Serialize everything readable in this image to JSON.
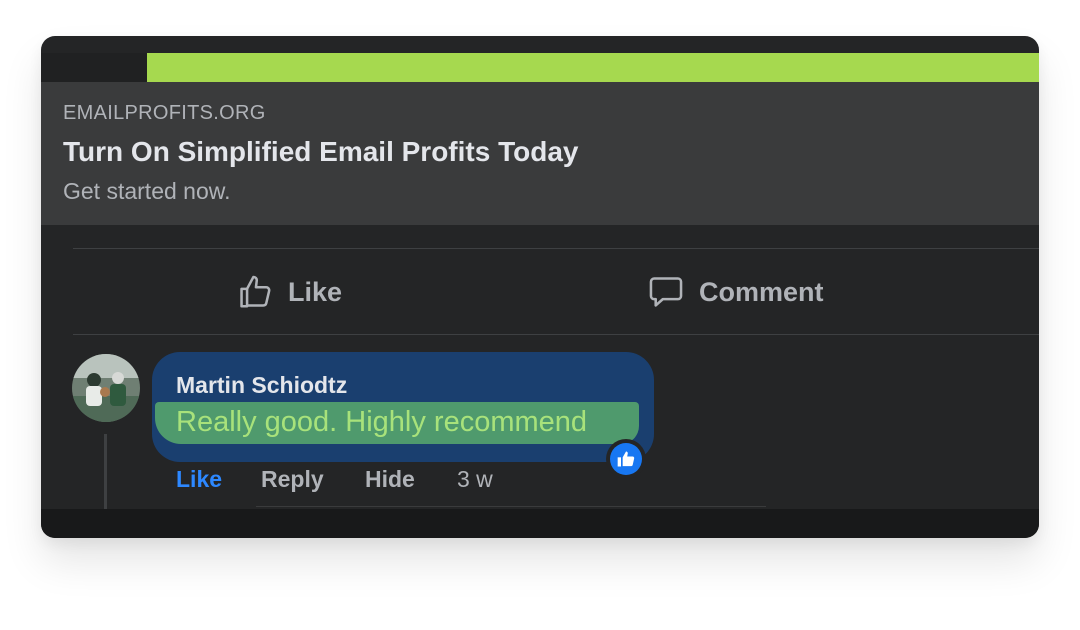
{
  "progress": {
    "fraction": 0.894,
    "color": "#a6d94f"
  },
  "link_preview": {
    "domain": "EMAILPROFITS.ORG",
    "title": "Turn On Simplified Email Profits Today",
    "subtitle": "Get started now."
  },
  "actions": {
    "like_label": "Like",
    "comment_label": "Comment",
    "like_icon": "thumbs-up-outline-icon",
    "comment_icon": "speech-bubble-icon"
  },
  "comment": {
    "author": "Martin Schiodtz",
    "text": "Really good. Highly recommend",
    "reaction_icon": "like-reaction-icon",
    "actions": {
      "like": "Like",
      "reply": "Reply",
      "hide": "Hide",
      "time": "3 w"
    }
  },
  "colors": {
    "background": "#242526",
    "preview_bg": "#3a3b3c",
    "bubble_bg": "#1a3f6f",
    "highlight": "#4f9a6d",
    "accent_blue": "#2d88ff"
  }
}
